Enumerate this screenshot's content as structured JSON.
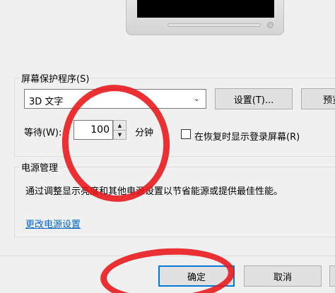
{
  "screensaver": {
    "group_label": "屏幕保护程序(S)",
    "selected": "3D 文字",
    "settings_label": "设置(T)...",
    "preview_label": "预览",
    "wait_label": "等待(W):",
    "wait_value": "100",
    "minutes_label": "分钟",
    "resume_checked": false,
    "resume_label": "在恢复时显示登录屏幕(R)"
  },
  "power": {
    "group_label": "电源管理",
    "description": "通过调整显示亮度和其他电源设置以节省能源或提供最佳性能。",
    "link_label": "更改电源设置"
  },
  "footer": {
    "ok_label": "确定",
    "cancel_label": "取消"
  },
  "annotation_color": "#e81418"
}
